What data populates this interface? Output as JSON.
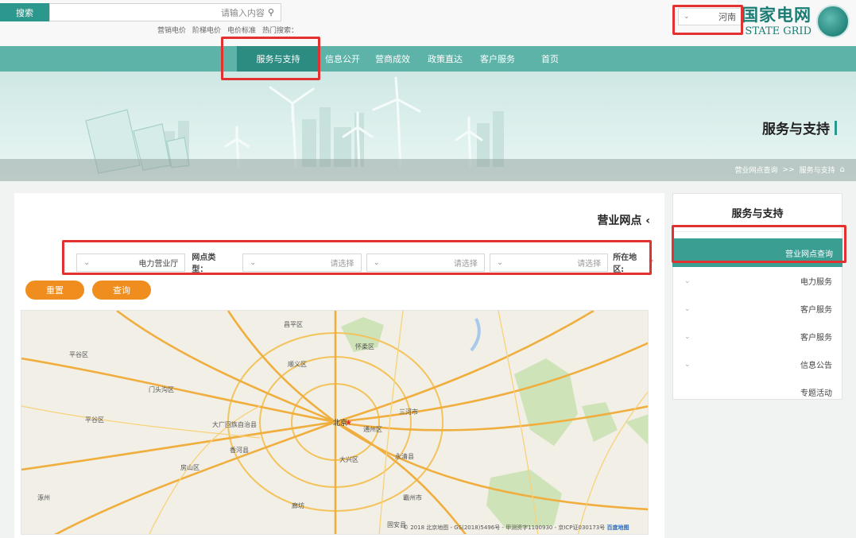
{
  "header": {
    "logo_cn": "国家电网",
    "logo_en": "STATE GRID",
    "region_selected": "河南",
    "search_placeholder": "请输入内容",
    "search_button": "搜索",
    "hot_label": "热门搜索：",
    "hot_items": [
      "电价标准",
      "阶梯电价",
      "营销电价"
    ]
  },
  "nav": {
    "items": [
      "首页",
      "客户服务",
      "政策直达",
      "营商成效",
      "信息公开",
      "服务与支持"
    ],
    "active": "服务与支持"
  },
  "banner": {
    "title": "服务与支持",
    "breadcrumb": [
      "服务与支持",
      ">>",
      "营业网点查询"
    ]
  },
  "sidebar": {
    "title": "服务与支持",
    "items": [
      {
        "label": "营业网点查询",
        "active": true
      },
      {
        "label": "电力服务"
      },
      {
        "label": "客户服务"
      },
      {
        "label": "客户服务"
      },
      {
        "label": "信息公告"
      },
      {
        "label": "专题活动"
      }
    ]
  },
  "main": {
    "title": "营业网点",
    "back": "‹",
    "region_label": "所在地区:",
    "region_selects": [
      "请选择",
      "请选择",
      "请选择"
    ],
    "type_label": "网点类型：",
    "type_value": "电力营业厅",
    "query_button": "查询",
    "reset_button": "重置"
  },
  "map": {
    "labels": [
      {
        "text": "北京",
        "kind": "city"
      },
      {
        "text": "顺义区"
      },
      {
        "text": "通州区"
      },
      {
        "text": "大兴区"
      },
      {
        "text": "房山区"
      },
      {
        "text": "门头沟区"
      },
      {
        "text": "昌平区"
      },
      {
        "text": "怀柔区"
      },
      {
        "text": "平谷区"
      },
      {
        "text": "三河市"
      },
      {
        "text": "廊坊"
      },
      {
        "text": "涿州"
      },
      {
        "text": "固安县"
      },
      {
        "text": "香河县"
      },
      {
        "text": "大厂回族自治县"
      },
      {
        "text": "永清县"
      },
      {
        "text": "霸州市"
      },
      {
        "text": "平谷区"
      }
    ],
    "footer": "© 2018 北京地图 - GS(2018)5496号 - 甲测资字1100930 - 京ICP证030173号",
    "baidu": "百度地图"
  },
  "colors": {
    "brand": "#2c978d",
    "nav": "#5db3a8",
    "accent": "#ef8e1e",
    "highlight": "#e23131"
  }
}
